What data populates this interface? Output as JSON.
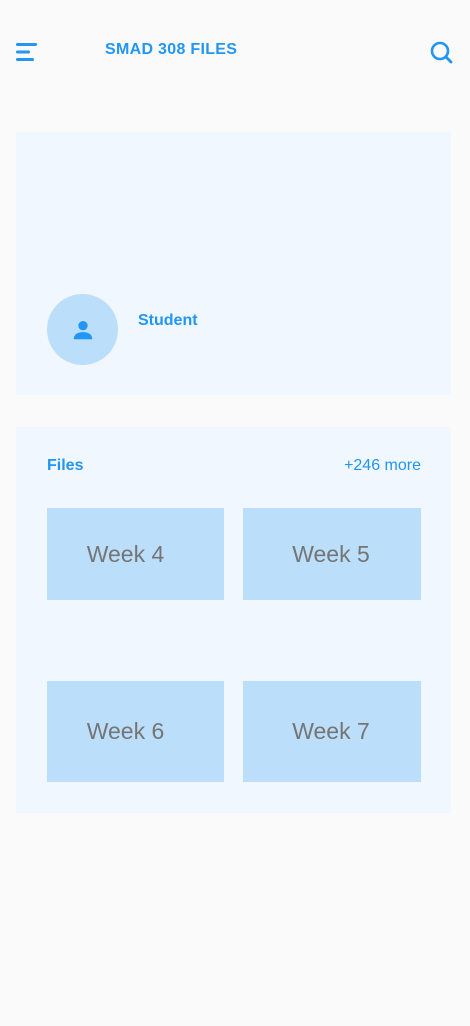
{
  "header": {
    "title": "SMAD 308 FILES",
    "menu_icon": "menu-icon",
    "search_icon": "search-icon"
  },
  "profile": {
    "name": "Student",
    "avatar_icon": "person-icon"
  },
  "files": {
    "title": "Files",
    "more_label": "+246 more",
    "tiles": [
      {
        "label": "Week 4"
      },
      {
        "label": "Week 5"
      },
      {
        "label": "Week 6"
      },
      {
        "label": "Week 7"
      }
    ]
  },
  "colors": {
    "accent": "#2196f3",
    "card_bg": "#f0f7fe",
    "tile_bg": "#bbdefb",
    "tile_text": "#757575",
    "page_bg": "#fafafa"
  }
}
